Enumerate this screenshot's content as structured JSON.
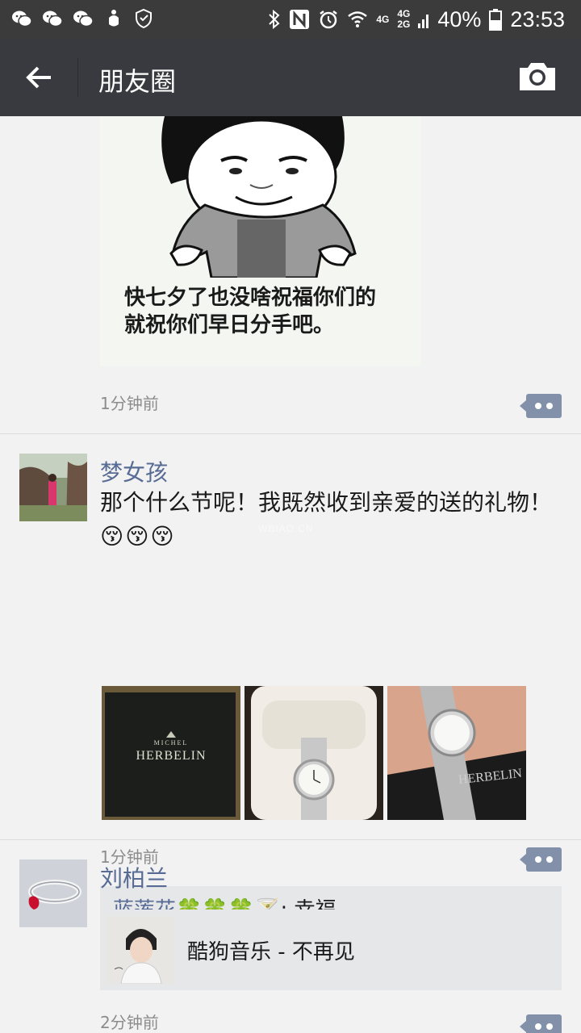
{
  "status_bar": {
    "battery_percent": "40%",
    "time": "23:53",
    "net_top": "4G",
    "net_pair_top": "4G",
    "net_pair_bottom": "2G"
  },
  "header": {
    "title": "朋友圈"
  },
  "posts": [
    {
      "image_caption_line1": "快七夕了也没啥祝福你们的",
      "image_caption_line2": "就祝你们早日分手吧。",
      "time": "1分钟前"
    },
    {
      "author": "梦女孩",
      "text_line1": "那个什么节呢！我既然收到亲爱的送的礼物！",
      "emoji": "😚😚😚",
      "box_brand_small": "MICHEL",
      "box_brand": "HERBELIN",
      "wrist_brand": "HERBELIN",
      "time": "1分钟前",
      "comments": [
        {
          "name": "蓝莲花🍀🍀🍀🍸",
          "text": ": 幸福"
        }
      ]
    },
    {
      "author": "刘柏兰",
      "share_title": "酷狗音乐 - 不再见",
      "time": "2分钟前"
    }
  ],
  "watermark": "WBIAO.CN",
  "colors": {
    "title_bar": "#393a3f",
    "status_bar": "#3b3b3b",
    "name_link": "#576b95",
    "comment_btn": "#8290aa",
    "background": "#f2f2f2"
  }
}
